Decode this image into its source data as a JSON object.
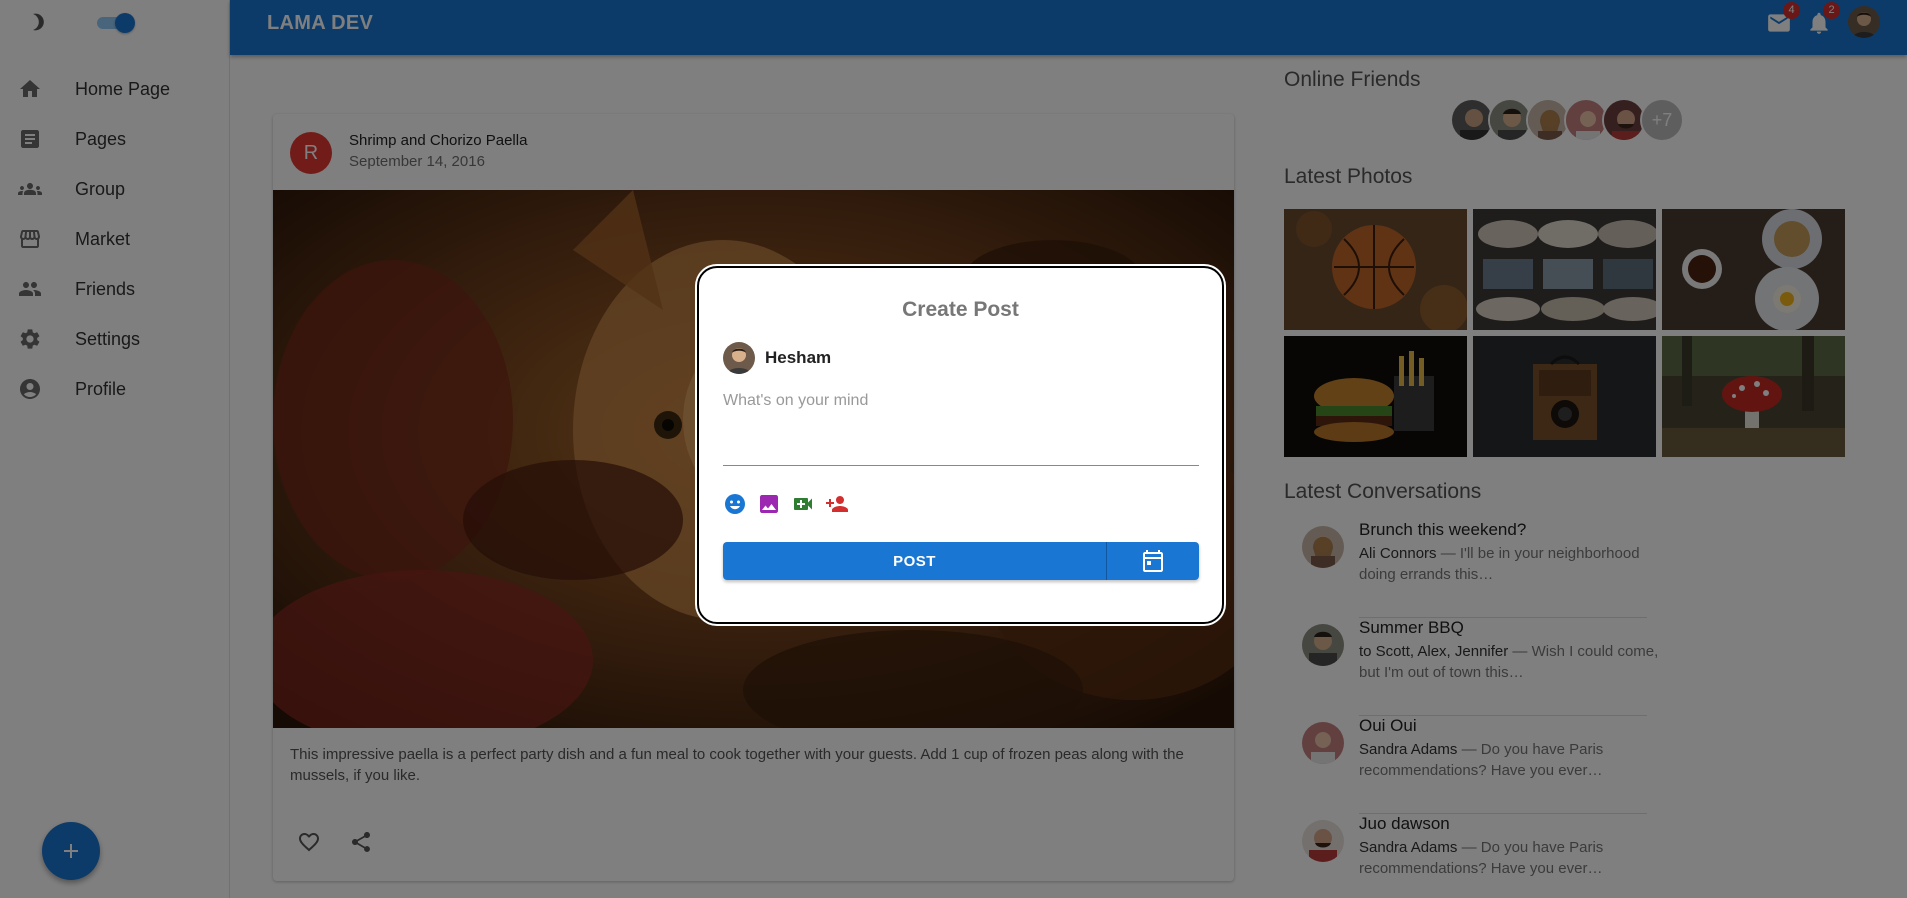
{
  "app": {
    "brand": "LAMA DEV"
  },
  "sidebar": {
    "items": [
      {
        "label": "Home Page",
        "icon": "home-icon"
      },
      {
        "label": "Pages",
        "icon": "article-icon"
      },
      {
        "label": "Group",
        "icon": "group-icon"
      },
      {
        "label": "Market",
        "icon": "storefront-icon"
      },
      {
        "label": "Friends",
        "icon": "person-icon"
      },
      {
        "label": "Settings",
        "icon": "settings-icon"
      },
      {
        "label": "Profile",
        "icon": "account-circle-icon"
      }
    ],
    "theme_toggle": {
      "on": true
    }
  },
  "topbar": {
    "mail_badge": "4",
    "notifications_badge": "2"
  },
  "post": {
    "avatar_letter": "R",
    "title": "Shrimp and Chorizo Paella",
    "date": "September 14, 2016",
    "text": "This impressive paella is a perfect party dish and a fun meal to cook together with your guests. Add 1 cup of frozen peas along with the mussels, if you like."
  },
  "rightbar": {
    "online_friends_title": "Online Friends",
    "more_friends": "+7",
    "latest_photos_title": "Latest Photos",
    "latest_conversations_title": "Latest Conversations",
    "conversations": [
      {
        "title": "Brunch this weekend?",
        "sender": "Ali Connors",
        "snippet": " — I'll be in your neighborhood doing errands this…"
      },
      {
        "title": "Summer BBQ",
        "sender": "to Scott, Alex, Jennifer",
        "snippet": " — Wish I could come, but I'm out of town this…"
      },
      {
        "title": "Oui Oui",
        "sender": "Sandra Adams",
        "snippet": " — Do you have Paris recommendations? Have you ever…"
      },
      {
        "title": "Juo dawson",
        "sender": "Sandra Adams",
        "snippet": " — Do you have Paris recommendations? Have you ever…"
      }
    ]
  },
  "modal": {
    "title": "Create Post",
    "username": "Hesham",
    "placeholder": "What's on your mind",
    "post_button": "POST"
  },
  "colors": {
    "primary": "#1976d2",
    "badge": "#d32f2f",
    "emoji_icon": "#1976d2",
    "image_icon": "#9c27b0",
    "video_icon": "#2e7d32",
    "person_add_icon": "#d32f2f"
  }
}
